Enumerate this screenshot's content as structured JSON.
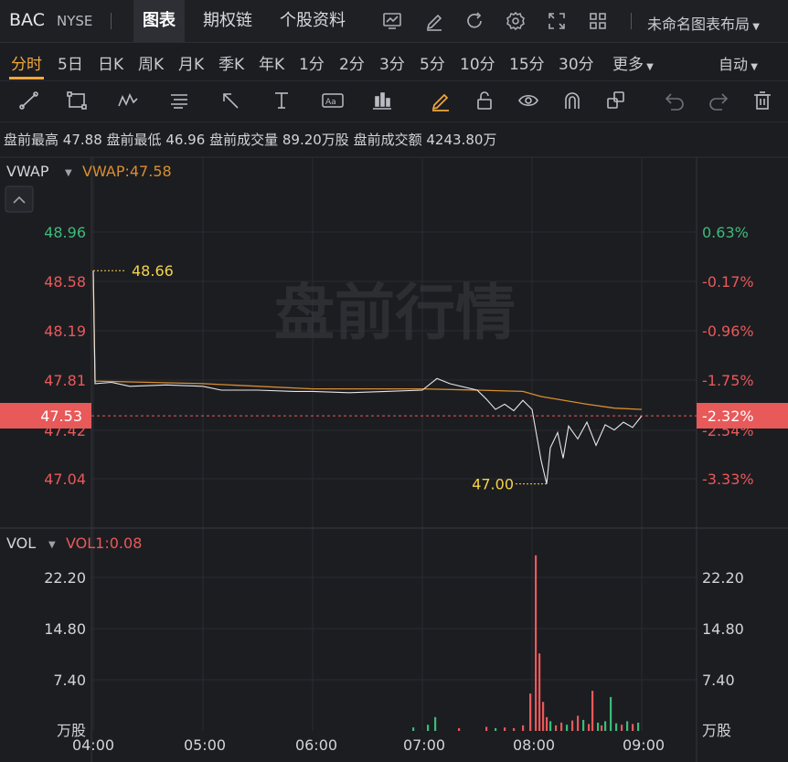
{
  "header": {
    "symbol": "BAC",
    "exchange": "NYSE",
    "tabs": [
      {
        "label": "图表",
        "active": true
      },
      {
        "label": "期权链",
        "active": false
      },
      {
        "label": "个股资料",
        "active": false
      }
    ],
    "toolbar_icons": [
      "chart-settings-icon",
      "edit-icon",
      "refresh-icon",
      "gear-icon",
      "expand-icon",
      "grid-layout-icon"
    ],
    "layout_name": "未命名图表布局"
  },
  "periods": {
    "items": [
      "分时",
      "5日",
      "日K",
      "周K",
      "月K",
      "季K",
      "年K",
      "1分",
      "2分",
      "3分",
      "5分",
      "10分",
      "15分",
      "30分"
    ],
    "active": "分时",
    "more_label": "更多",
    "scale_mode": "自动"
  },
  "drawing_tools": [
    "trend-line-icon",
    "rectangle-icon",
    "pattern-icon",
    "fib-icon",
    "arrow-icon",
    "text-tool-icon",
    "label-icon",
    "candle-icon",
    "brush-icon",
    "lock-icon",
    "eye-icon",
    "magnet-icon",
    "layers-icon",
    "undo-icon",
    "redo-icon",
    "trash-icon"
  ],
  "premarket_info": {
    "high_label": "盘前最高",
    "high": "47.88",
    "low_label": "盘前最低",
    "low": "46.96",
    "volume_label": "盘前成交量",
    "volume": "89.20万股",
    "amount_label": "盘前成交额",
    "amount": "4243.80万"
  },
  "colors": {
    "up": "#3dbb7a",
    "down": "#e8595a",
    "price_line": "#e6e7ea",
    "vwap_line": "#d98e2f",
    "accent": "#f0a83c",
    "annotation": "#f5d24a",
    "current_price_bg": "#e8595a"
  },
  "price_panel": {
    "indicator_label": "VWAP",
    "indicator_value": "VWAP:47.58",
    "watermark": "盘前行情",
    "y_ticks": [
      "48.96",
      "48.58",
      "48.19",
      "47.81",
      "47.42",
      "47.04"
    ],
    "pct_ticks": [
      "0.63%",
      "-0.17%",
      "-0.96%",
      "-1.75%",
      "-2.54%",
      "-3.33%"
    ],
    "current_price": "47.53",
    "current_pct": "-2.32%",
    "high_annotation": "48.66",
    "low_annotation": "47.00"
  },
  "volume_panel": {
    "indicator_label": "VOL",
    "indicator_value": "VOL1:0.08",
    "y_ticks": [
      "22.20",
      "14.80",
      "7.40"
    ],
    "unit": "万股"
  },
  "x_axis": {
    "labels": [
      "04:00",
      "05:00",
      "06:00",
      "07:00",
      "08:00",
      "09:00"
    ]
  },
  "chart_data": {
    "type": "line",
    "x_range": [
      "04:00",
      "09:10"
    ],
    "price": {
      "ylim": [
        46.85,
        49.05
      ],
      "series": [
        {
          "t": "04:00",
          "v": 48.66
        },
        {
          "t": "04:01",
          "v": 47.78
        },
        {
          "t": "04:10",
          "v": 47.79
        },
        {
          "t": "04:20",
          "v": 47.76
        },
        {
          "t": "04:40",
          "v": 47.77
        },
        {
          "t": "05:00",
          "v": 47.76
        },
        {
          "t": "05:10",
          "v": 47.73
        },
        {
          "t": "05:30",
          "v": 47.73
        },
        {
          "t": "05:50",
          "v": 47.72
        },
        {
          "t": "06:00",
          "v": 47.72
        },
        {
          "t": "06:20",
          "v": 47.71
        },
        {
          "t": "06:40",
          "v": 47.72
        },
        {
          "t": "07:00",
          "v": 47.73
        },
        {
          "t": "07:08",
          "v": 47.82
        },
        {
          "t": "07:15",
          "v": 47.78
        },
        {
          "t": "07:30",
          "v": 47.73
        },
        {
          "t": "07:35",
          "v": 47.66
        },
        {
          "t": "07:40",
          "v": 47.58
        },
        {
          "t": "07:45",
          "v": 47.62
        },
        {
          "t": "07:50",
          "v": 47.57
        },
        {
          "t": "07:55",
          "v": 47.65
        },
        {
          "t": "08:00",
          "v": 47.58
        },
        {
          "t": "08:05",
          "v": 47.18
        },
        {
          "t": "08:08",
          "v": 47.0
        },
        {
          "t": "08:10",
          "v": 47.28
        },
        {
          "t": "08:14",
          "v": 47.4
        },
        {
          "t": "08:17",
          "v": 47.2
        },
        {
          "t": "08:20",
          "v": 47.45
        },
        {
          "t": "08:25",
          "v": 47.35
        },
        {
          "t": "08:30",
          "v": 47.48
        },
        {
          "t": "08:35",
          "v": 47.3
        },
        {
          "t": "08:40",
          "v": 47.46
        },
        {
          "t": "08:45",
          "v": 47.42
        },
        {
          "t": "08:50",
          "v": 47.48
        },
        {
          "t": "08:55",
          "v": 47.44
        },
        {
          "t": "09:00",
          "v": 47.53
        }
      ]
    },
    "vwap": {
      "series": [
        {
          "t": "04:00",
          "v": 48.66
        },
        {
          "t": "04:01",
          "v": 47.8
        },
        {
          "t": "05:00",
          "v": 47.78
        },
        {
          "t": "06:00",
          "v": 47.74
        },
        {
          "t": "07:00",
          "v": 47.74
        },
        {
          "t": "07:30",
          "v": 47.73
        },
        {
          "t": "07:55",
          "v": 47.72
        },
        {
          "t": "08:05",
          "v": 47.68
        },
        {
          "t": "08:30",
          "v": 47.62
        },
        {
          "t": "08:45",
          "v": 47.59
        },
        {
          "t": "09:00",
          "v": 47.58
        }
      ]
    },
    "volume": {
      "ylim": [
        0,
        27
      ],
      "bars": [
        {
          "t": "06:55",
          "v": 0.5,
          "dir": "up"
        },
        {
          "t": "07:03",
          "v": 0.9,
          "dir": "up"
        },
        {
          "t": "07:07",
          "v": 2.0,
          "dir": "up"
        },
        {
          "t": "07:20",
          "v": 0.4,
          "dir": "down"
        },
        {
          "t": "07:35",
          "v": 0.6,
          "dir": "down"
        },
        {
          "t": "07:40",
          "v": 0.4,
          "dir": "up"
        },
        {
          "t": "07:45",
          "v": 0.5,
          "dir": "down"
        },
        {
          "t": "07:50",
          "v": 0.4,
          "dir": "down"
        },
        {
          "t": "07:55",
          "v": 0.8,
          "dir": "down"
        },
        {
          "t": "07:59",
          "v": 5.4,
          "dir": "down"
        },
        {
          "t": "08:02",
          "v": 25.4,
          "dir": "down"
        },
        {
          "t": "08:04",
          "v": 11.2,
          "dir": "down"
        },
        {
          "t": "08:06",
          "v": 4.2,
          "dir": "down"
        },
        {
          "t": "08:08",
          "v": 2.0,
          "dir": "down"
        },
        {
          "t": "08:10",
          "v": 1.4,
          "dir": "up"
        },
        {
          "t": "08:13",
          "v": 0.8,
          "dir": "down"
        },
        {
          "t": "08:16",
          "v": 1.2,
          "dir": "down"
        },
        {
          "t": "08:19",
          "v": 0.9,
          "dir": "up"
        },
        {
          "t": "08:22",
          "v": 1.5,
          "dir": "down"
        },
        {
          "t": "08:25",
          "v": 2.2,
          "dir": "down"
        },
        {
          "t": "08:28",
          "v": 1.6,
          "dir": "up"
        },
        {
          "t": "08:31",
          "v": 1.0,
          "dir": "down"
        },
        {
          "t": "08:33",
          "v": 5.8,
          "dir": "down"
        },
        {
          "t": "08:36",
          "v": 1.2,
          "dir": "up"
        },
        {
          "t": "08:38",
          "v": 0.8,
          "dir": "down"
        },
        {
          "t": "08:40",
          "v": 1.4,
          "dir": "up"
        },
        {
          "t": "08:43",
          "v": 4.9,
          "dir": "up"
        },
        {
          "t": "08:46",
          "v": 1.1,
          "dir": "up"
        },
        {
          "t": "08:49",
          "v": 0.9,
          "dir": "down"
        },
        {
          "t": "08:52",
          "v": 1.4,
          "dir": "up"
        },
        {
          "t": "08:55",
          "v": 1.0,
          "dir": "down"
        },
        {
          "t": "08:58",
          "v": 1.2,
          "dir": "up"
        }
      ]
    }
  }
}
